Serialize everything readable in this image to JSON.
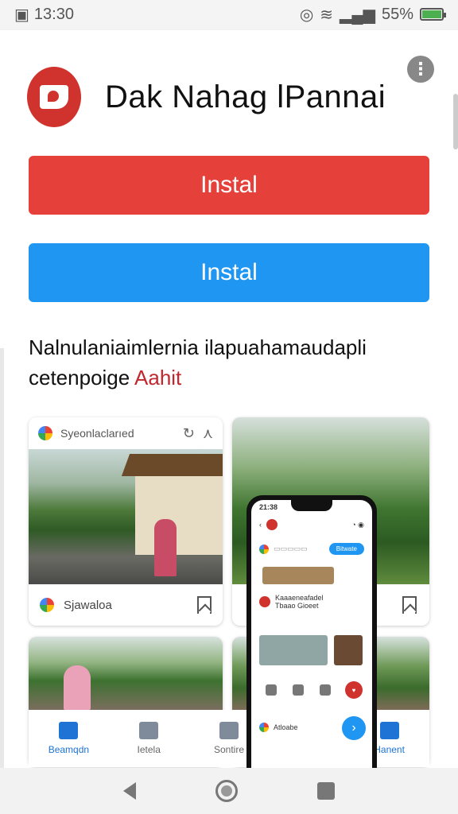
{
  "status_bar": {
    "time": "13:30",
    "battery": "55%",
    "icons": [
      "gallery-icon",
      "alarm-icon",
      "wifi-icon",
      "signal-icon",
      "battery-icon"
    ]
  },
  "app": {
    "title": "Dak Nahag lPannai",
    "more_icon": "more-vert-icon",
    "install_primary_label": "Instal",
    "install_secondary_label": "Instal",
    "brand_red": "#e5413a",
    "brand_blue": "#1e96f2"
  },
  "description": {
    "line1": "Nalnulaniaimlernia ilapuahamaudapli",
    "line2_text": "cetenpoige ",
    "line2_accent": "Aahit"
  },
  "cards": {
    "card1": {
      "header_title": "Syeonlaclarıed",
      "footer_label": "Sjawaloa"
    }
  },
  "phone_mockup": {
    "time": "21:38",
    "pill_label": "Bitwate",
    "list_title": "Kaaaeneafadel",
    "list_sub": "Tbaao Gioeet",
    "bottom_text": "Atloabe"
  },
  "bottom_tabs": [
    {
      "label": "Beamqdn",
      "active": true
    },
    {
      "label": "Ietela",
      "active": false
    },
    {
      "label": "Sontire",
      "active": false
    },
    {
      "label": "",
      "active": false
    },
    {
      "label": "Hanent",
      "active": true
    }
  ],
  "nav_bar": {
    "icons": [
      "back-icon",
      "home-icon",
      "recents-icon"
    ]
  }
}
